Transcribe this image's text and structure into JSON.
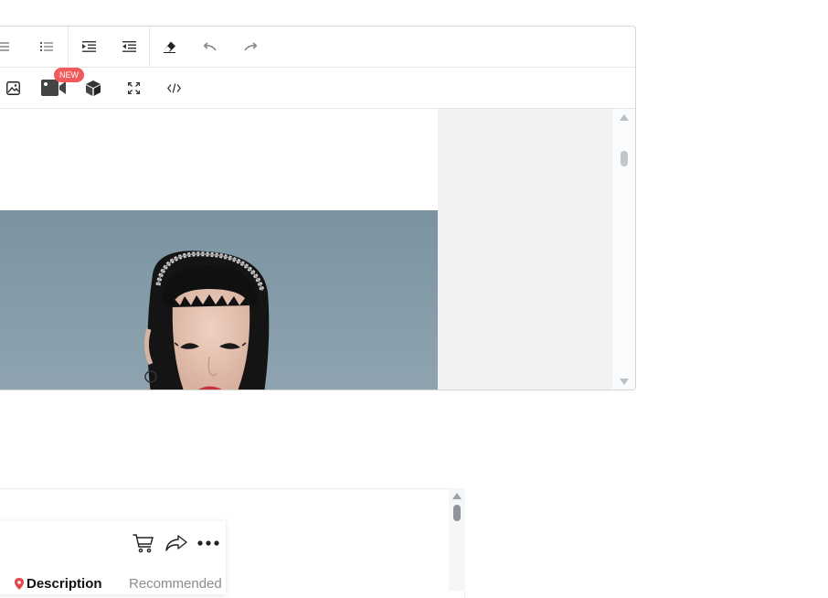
{
  "toolbar": {
    "row1": [
      {
        "name": "bulleted-list-icon"
      },
      {
        "name": "numbered-list-icon"
      },
      {
        "name": "indent-increase-icon"
      },
      {
        "name": "indent-decrease-icon"
      },
      {
        "name": "eraser-icon"
      },
      {
        "name": "undo-icon"
      },
      {
        "name": "redo-icon"
      }
    ],
    "row2": [
      {
        "name": "image-icon"
      },
      {
        "name": "video-icon"
      },
      {
        "name": "3d-cube-icon"
      },
      {
        "name": "fullscreen-icon"
      },
      {
        "name": "source-code-icon"
      }
    ],
    "new_badge": "NEW"
  },
  "colors": {
    "badge": "#f05a5a",
    "photo_background": "#7d95a3",
    "side_panel": "#f3f2f0"
  },
  "preview": {
    "icons": [
      "cart-icon",
      "share-icon",
      "more-icon"
    ],
    "tabs": [
      {
        "label": "Description",
        "active": true
      },
      {
        "label": "Recommended",
        "active": false
      }
    ]
  }
}
